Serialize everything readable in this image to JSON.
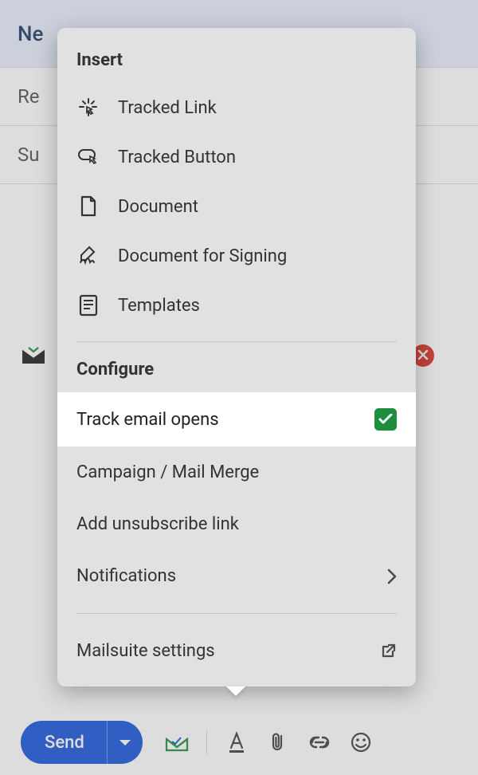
{
  "compose": {
    "title_prefix": "Ne",
    "recipients_label": "Re",
    "subject_label": "Su"
  },
  "send": {
    "label": "Send"
  },
  "popup": {
    "insert_title": "Insert",
    "items": [
      {
        "label": "Tracked Link"
      },
      {
        "label": "Tracked Button"
      },
      {
        "label": "Document"
      },
      {
        "label": "Document for Signing"
      },
      {
        "label": "Templates"
      }
    ],
    "configure_title": "Configure",
    "configure": [
      {
        "label": "Track email opens"
      },
      {
        "label": "Campaign / Mail Merge"
      },
      {
        "label": "Add unsubscribe link"
      },
      {
        "label": "Notifications"
      },
      {
        "label": "Mailsuite settings"
      }
    ]
  }
}
